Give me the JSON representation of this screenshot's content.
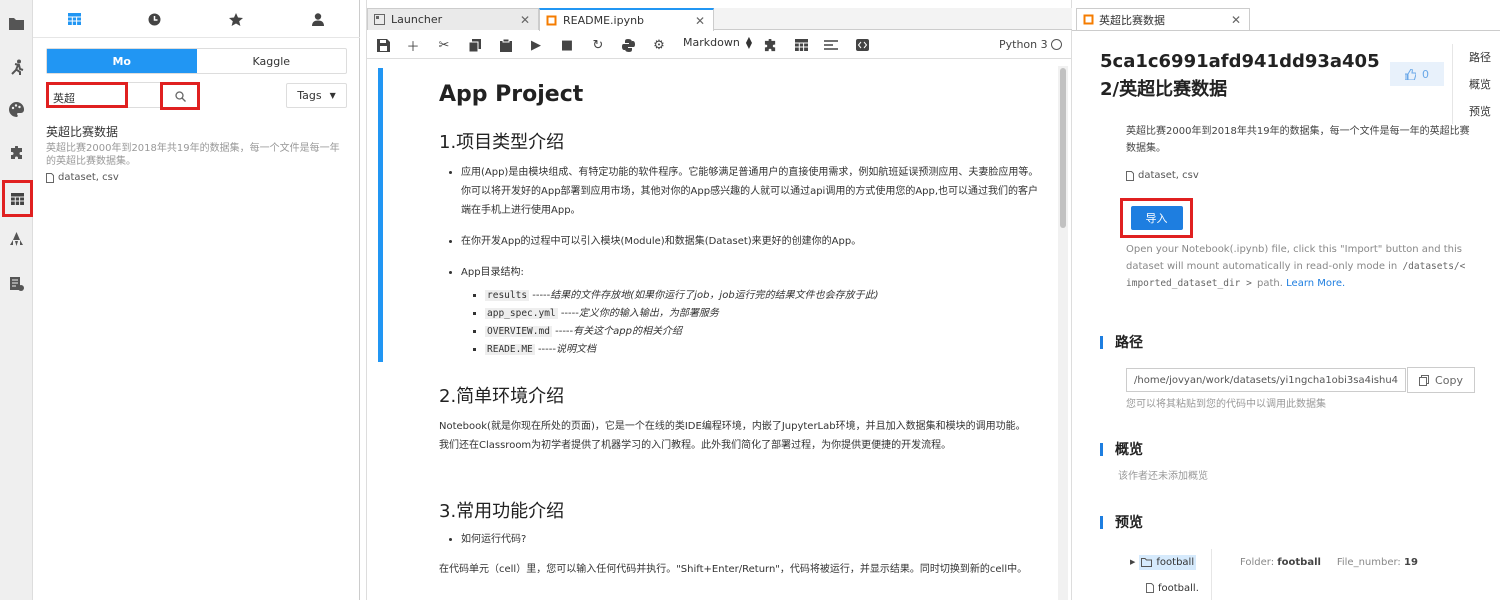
{
  "iconbar": {
    "icons": [
      "folder-icon",
      "running-icon",
      "palette-icon",
      "extension-icon",
      "dataset-icon",
      "rocket-icon",
      "notebook-list-icon"
    ]
  },
  "dataset_panel": {
    "tab_icons": [
      "table-icon",
      "clock-icon",
      "star-icon",
      "user-icon"
    ],
    "source_tabs": [
      "Mo",
      "Kaggle"
    ],
    "search_value": "英超",
    "tags_label": "Tags",
    "result": {
      "title": "英超比赛数据",
      "description": "英超比赛2000年到2018年共19年的数据集，每一个文件是每一年的英超比赛数据集。",
      "files": "dataset, csv"
    }
  },
  "notebook": {
    "tabs": [
      {
        "label": "Launcher"
      },
      {
        "label": "README.ipynb"
      }
    ],
    "cell_type": "Markdown",
    "kernel": "Python 3",
    "content": {
      "h1": "App Project",
      "s1": "1.项目类型介绍",
      "b1": "应用(App)是由模块组成、有特定功能的软件程序。它能够满足普通用户的直接使用需求，例如航班延误预测应用、夫妻脸应用等。你可以将开发好的App部署到应用市场，其他对你的App感兴趣的人就可以通过api调用的方式使用您的App,也可以通过我们的客户端在手机上进行使用App。",
      "b2": "在你开发App的过程中可以引入模块(Module)和数据集(Dataset)来更好的创建你的App。",
      "b3": "App目录结构:",
      "files": [
        {
          "code": "results",
          "desc": "结果的文件存放地(如果你运行了job，job运行完的结果文件也会存放于此)"
        },
        {
          "code": "app_spec.yml",
          "desc": "定义你的输入输出，为部署服务"
        },
        {
          "code": "OVERVIEW.md",
          "desc": "有关这个app的相关介绍"
        },
        {
          "code": "READE.ME",
          "desc": "说明文档"
        }
      ],
      "sep": "-----",
      "s2": "2.简单环境介绍",
      "p2": "Notebook(就是你现在所处的页面)，它是一个在线的类IDE编程环境，内嵌了JupyterLab环境，并且加入数据集和模块的调用功能。我们还在Classroom为初学者提供了机器学习的入门教程。此外我们简化了部署过程，为你提供更便捷的开发流程。",
      "s3": "3.常用功能介绍",
      "b4": "如何运行代码?",
      "p3": "在代码单元（cell）里，您可以输入任何代码并执行。\"Shift+Enter/Return\"，代码将被运行，并显示结果。同时切换到新的cell中。"
    }
  },
  "right_panel": {
    "tab_label": "英超比赛数据",
    "title": "5ca1c6991afd941dd93a4052/英超比赛数据",
    "likes": "0",
    "toc": [
      "路径",
      "概览",
      "预览"
    ],
    "description": "英超比赛2000年到2018年共19年的数据集，每一个文件是每一年的英超比赛数据集。",
    "files": "dataset, csv",
    "import_label": "导入",
    "import_hint_1": "Open your Notebook(.ipynb) file, click this \"Import\" button and this dataset will mount automatically in read-only mode in",
    "import_hint_code": "/datasets/< imported_dataset_dir >",
    "import_hint_2": "path.",
    "learn_more": "Learn More.",
    "path_heading": "路径",
    "path_value": "/home/jovyan/work/datasets/yi1ngcha1obi3sa4ishu4",
    "copy_label": "Copy",
    "path_hint": "您可以将其粘贴到您的代码中以调用此数据集",
    "overview_heading": "概览",
    "overview_text": "该作者还未添加概览",
    "preview_heading": "预览",
    "tree": [
      {
        "label": "football"
      },
      {
        "label": "football."
      }
    ],
    "folder_label": "Folder:",
    "folder_value": "football",
    "file_number_label": "File_number:",
    "file_number_value": "19"
  }
}
